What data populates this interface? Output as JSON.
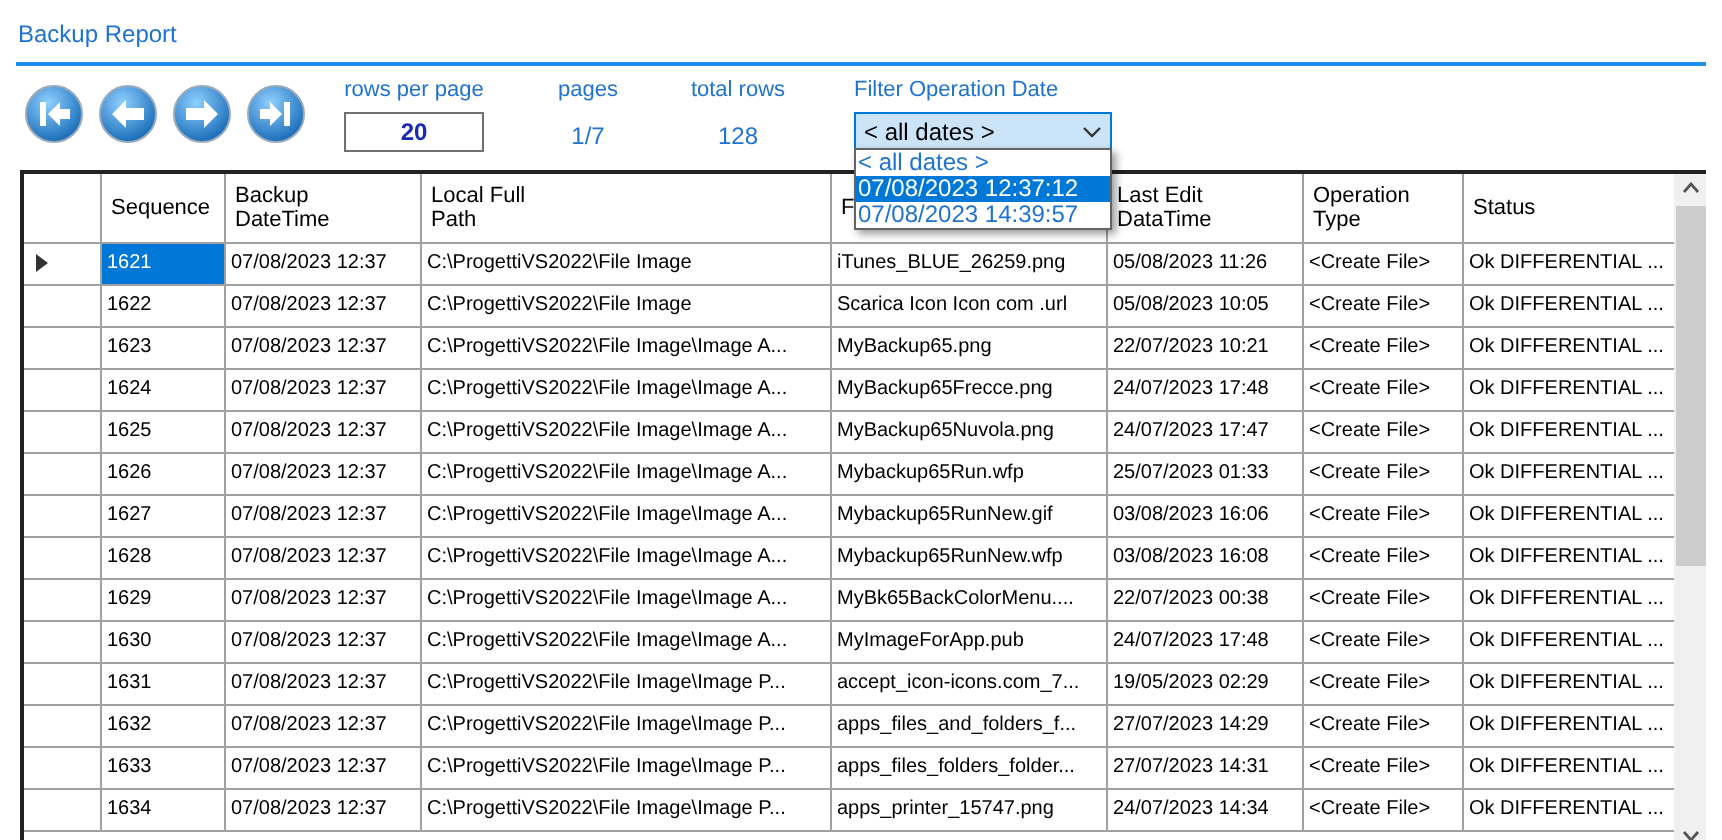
{
  "title": "Backup Report",
  "nav_buttons": [
    {
      "kind": "first"
    },
    {
      "kind": "prev"
    },
    {
      "kind": "next"
    },
    {
      "kind": "last"
    }
  ],
  "rows_per_page": {
    "label": "rows per page",
    "value": "20"
  },
  "pages": {
    "label": "pages",
    "value": "1/7"
  },
  "total_rows": {
    "label": "total rows",
    "value": "128"
  },
  "filter": {
    "label": "Filter Operation Date",
    "value": "< all dates >",
    "expanded": true,
    "options": [
      {
        "label": "< all dates >",
        "highlighted": false
      },
      {
        "label": "07/08/2023 12:37:12",
        "highlighted": true
      },
      {
        "label": "07/08/2023 14:39:57",
        "highlighted": false
      }
    ]
  },
  "table": {
    "columns": [
      "Sequence",
      "Backup DateTime",
      "Local Full Path",
      "F",
      "Last Edit DataTime",
      "Operation Type",
      "Status"
    ],
    "rows": [
      {
        "selected": true,
        "cells": [
          "1621",
          "07/08/2023 12:37",
          "C:\\ProgettiVS2022\\File Image",
          "iTunes_BLUE_26259.png",
          "05/08/2023 11:26",
          "<Create File>",
          "Ok DIFFERENTIAL ..."
        ]
      },
      {
        "selected": false,
        "cells": [
          "1622",
          "07/08/2023 12:37",
          "C:\\ProgettiVS2022\\File Image",
          "Scarica Icon Icon com .url",
          "05/08/2023 10:05",
          "<Create File>",
          "Ok DIFFERENTIAL ..."
        ]
      },
      {
        "selected": false,
        "cells": [
          "1623",
          "07/08/2023 12:37",
          "C:\\ProgettiVS2022\\File Image\\Image A...",
          "MyBackup65.png",
          "22/07/2023 10:21",
          "<Create File>",
          "Ok DIFFERENTIAL ..."
        ]
      },
      {
        "selected": false,
        "cells": [
          "1624",
          "07/08/2023 12:37",
          "C:\\ProgettiVS2022\\File Image\\Image A...",
          "MyBackup65Frecce.png",
          "24/07/2023 17:48",
          "<Create File>",
          "Ok DIFFERENTIAL ..."
        ]
      },
      {
        "selected": false,
        "cells": [
          "1625",
          "07/08/2023 12:37",
          "C:\\ProgettiVS2022\\File Image\\Image A...",
          "MyBackup65Nuvola.png",
          "24/07/2023 17:47",
          "<Create File>",
          "Ok DIFFERENTIAL ..."
        ]
      },
      {
        "selected": false,
        "cells": [
          "1626",
          "07/08/2023 12:37",
          "C:\\ProgettiVS2022\\File Image\\Image A...",
          "Mybackup65Run.wfp",
          "25/07/2023 01:33",
          "<Create File>",
          "Ok DIFFERENTIAL ..."
        ]
      },
      {
        "selected": false,
        "cells": [
          "1627",
          "07/08/2023 12:37",
          "C:\\ProgettiVS2022\\File Image\\Image A...",
          "Mybackup65RunNew.gif",
          "03/08/2023 16:06",
          "<Create File>",
          "Ok DIFFERENTIAL ..."
        ]
      },
      {
        "selected": false,
        "cells": [
          "1628",
          "07/08/2023 12:37",
          "C:\\ProgettiVS2022\\File Image\\Image A...",
          "Mybackup65RunNew.wfp",
          "03/08/2023 16:08",
          "<Create File>",
          "Ok DIFFERENTIAL ..."
        ]
      },
      {
        "selected": false,
        "cells": [
          "1629",
          "07/08/2023 12:37",
          "C:\\ProgettiVS2022\\File Image\\Image A...",
          "MyBk65BackColorMenu....",
          "22/07/2023 00:38",
          "<Create File>",
          "Ok DIFFERENTIAL ..."
        ]
      },
      {
        "selected": false,
        "cells": [
          "1630",
          "07/08/2023 12:37",
          "C:\\ProgettiVS2022\\File Image\\Image A...",
          "MyImageForApp.pub",
          "24/07/2023 17:48",
          "<Create File>",
          "Ok DIFFERENTIAL ..."
        ]
      },
      {
        "selected": false,
        "cells": [
          "1631",
          "07/08/2023 12:37",
          "C:\\ProgettiVS2022\\File Image\\Image P...",
          "accept_icon-icons.com_7...",
          "19/05/2023 02:29",
          "<Create File>",
          "Ok DIFFERENTIAL ..."
        ]
      },
      {
        "selected": false,
        "cells": [
          "1632",
          "07/08/2023 12:37",
          "C:\\ProgettiVS2022\\File Image\\Image P...",
          "apps_files_and_folders_f...",
          "27/07/2023 14:29",
          "<Create File>",
          "Ok DIFFERENTIAL ..."
        ]
      },
      {
        "selected": false,
        "cells": [
          "1633",
          "07/08/2023 12:37",
          "C:\\ProgettiVS2022\\File Image\\Image P...",
          "apps_files_folders_folder...",
          "27/07/2023 14:31",
          "<Create File>",
          "Ok DIFFERENTIAL ..."
        ]
      },
      {
        "selected": false,
        "cells": [
          "1634",
          "07/08/2023 12:37",
          "C:\\ProgettiVS2022\\File Image\\Image P...",
          "apps_printer_15747.png",
          "24/07/2023 14:34",
          "<Create File>",
          "Ok DIFFERENTIAL ..."
        ]
      }
    ]
  }
}
